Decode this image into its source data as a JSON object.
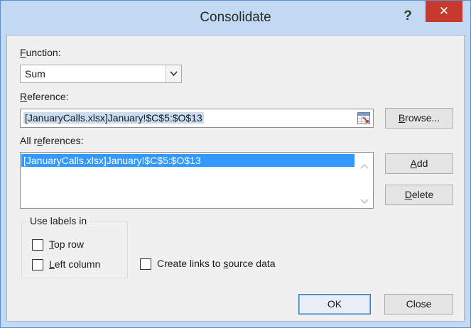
{
  "window": {
    "title": "Consolidate",
    "help_label": "?",
    "close_label": "✕"
  },
  "function": {
    "label_first": "F",
    "label_rest": "unction:",
    "value": "Sum"
  },
  "reference": {
    "label_first": "R",
    "label_rest": "eference:",
    "value": "[JanuaryCalls.xlsx]January!$C$5:$O$13"
  },
  "all_references": {
    "label_pre": "All r",
    "label_u": "e",
    "label_post": "ferences:",
    "items": [
      "[JanuaryCalls.xlsx]January!$C$5:$O$13"
    ]
  },
  "buttons": {
    "browse": {
      "first": "B",
      "rest": "rowse..."
    },
    "add": {
      "first": "A",
      "rest": "dd"
    },
    "delete": {
      "first": "D",
      "rest": "elete"
    },
    "ok": "OK",
    "close": "Close"
  },
  "use_labels": {
    "legend": "Use labels in",
    "top_row": {
      "first": "T",
      "rest": "op row",
      "checked": false
    },
    "left_column": {
      "first": "L",
      "rest": "eft column",
      "checked": false
    }
  },
  "create_links": {
    "pre": "Create links to ",
    "u": "s",
    "post": "ource data",
    "checked": false
  },
  "colors": {
    "title_bar": "#c3d9f2",
    "close_button": "#c7392c",
    "selection": "#3399ff"
  }
}
